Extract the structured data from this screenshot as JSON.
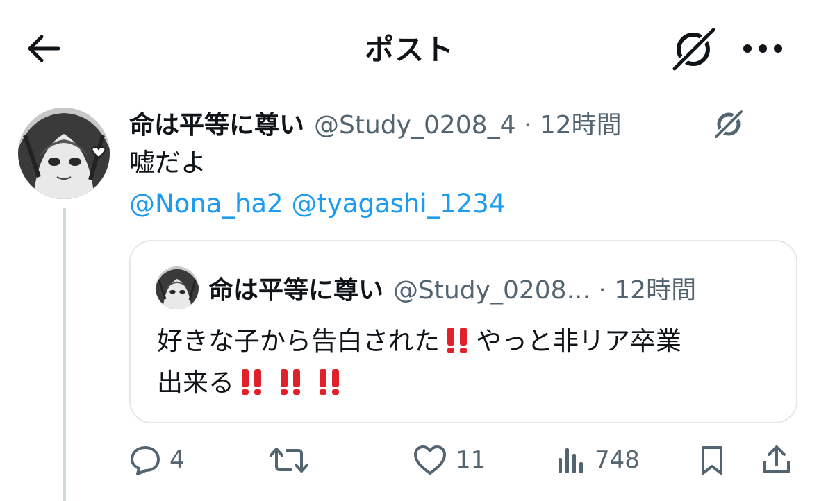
{
  "header": {
    "title": "ポスト",
    "back_icon": "arrow-left-icon",
    "grok_icon": "grok-icon",
    "more_icon": "more-horizontal-icon"
  },
  "tweet": {
    "display_name": "命は平等に尊い",
    "handle": "@Study_0208_4",
    "separator": "·",
    "time": "12時間",
    "text": "嘘だよ",
    "mentions": [
      "@Nona_ha2",
      "@tyagashi_1234"
    ]
  },
  "quote": {
    "display_name": "命は平等に尊い",
    "handle": "@Study_0208...",
    "separator": "·",
    "time": "12時間",
    "text_line1_a": "好きな子から告白された",
    "text_line1_b": "やっと非リア卒業",
    "text_line2": "出来る"
  },
  "actions": {
    "replies": "4",
    "likes": "11",
    "views": "748"
  },
  "colors": {
    "accent": "#1d9bf0",
    "muted": "#536471",
    "text": "#0f1419",
    "border": "#e1e8ed",
    "thread_line": "#cfd9de",
    "emoji_red": "#e0202a"
  }
}
